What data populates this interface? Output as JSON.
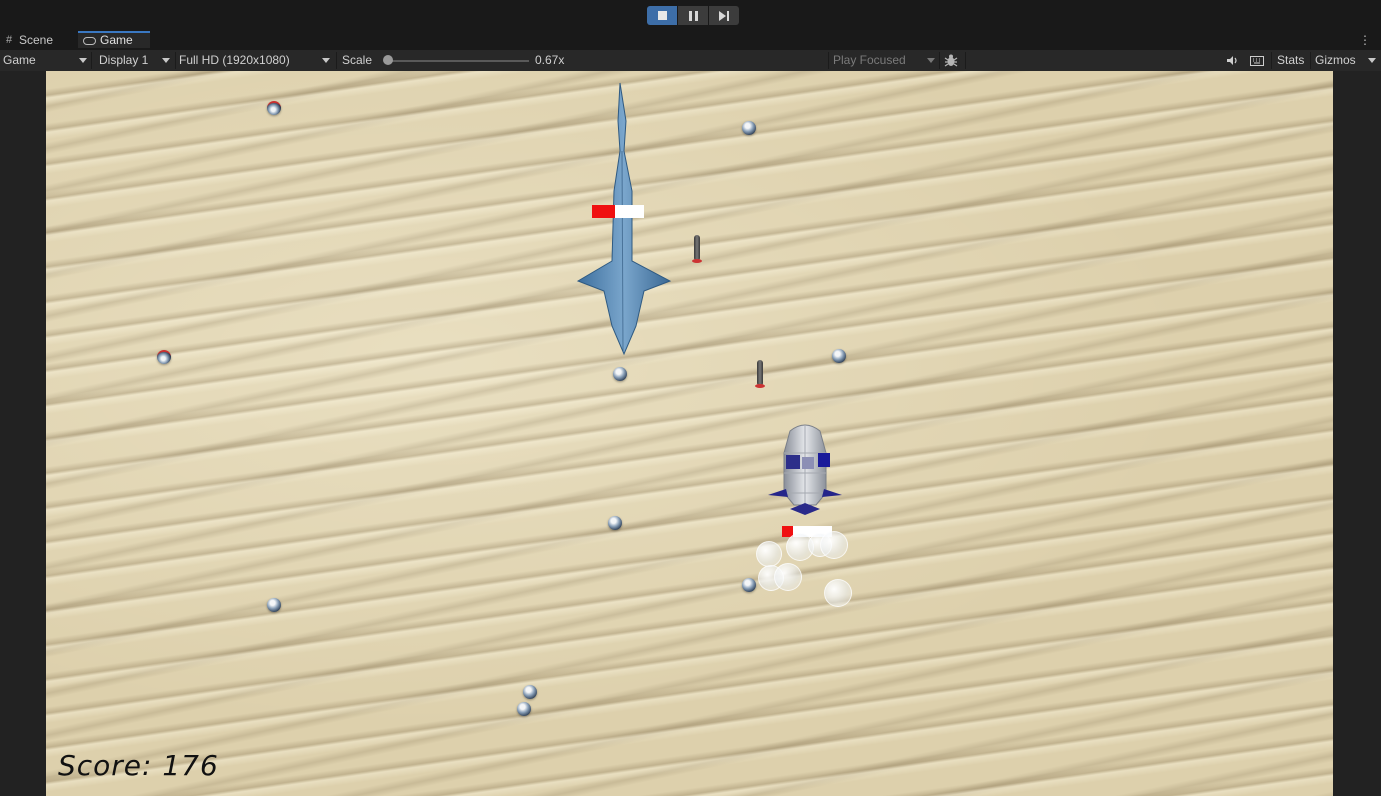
{
  "playbar": {
    "stop": "stop-icon",
    "pause": "pause-icon",
    "step": "step-icon"
  },
  "tabs": [
    {
      "label": "Scene",
      "icon": "grid-icon"
    },
    {
      "label": "Game",
      "icon": "gamepad-icon"
    }
  ],
  "toolbar": {
    "view_mode": "Game",
    "display": "Display 1",
    "resolution": "Full HD (1920x1080)",
    "scale_label": "Scale",
    "scale_value": "0.67x",
    "scale_fraction": 0.03,
    "play_mode": "Play Focused",
    "stats_label": "Stats",
    "gizmos_label": "Gizmos"
  },
  "game": {
    "score_text": "Score: 176",
    "shark_health_fraction": 0.45,
    "sub_health_fraction": 0.22
  },
  "colors": {
    "accent": "#3d6ea8",
    "sand": "#ddd0ac",
    "health_red": "#f01010"
  }
}
